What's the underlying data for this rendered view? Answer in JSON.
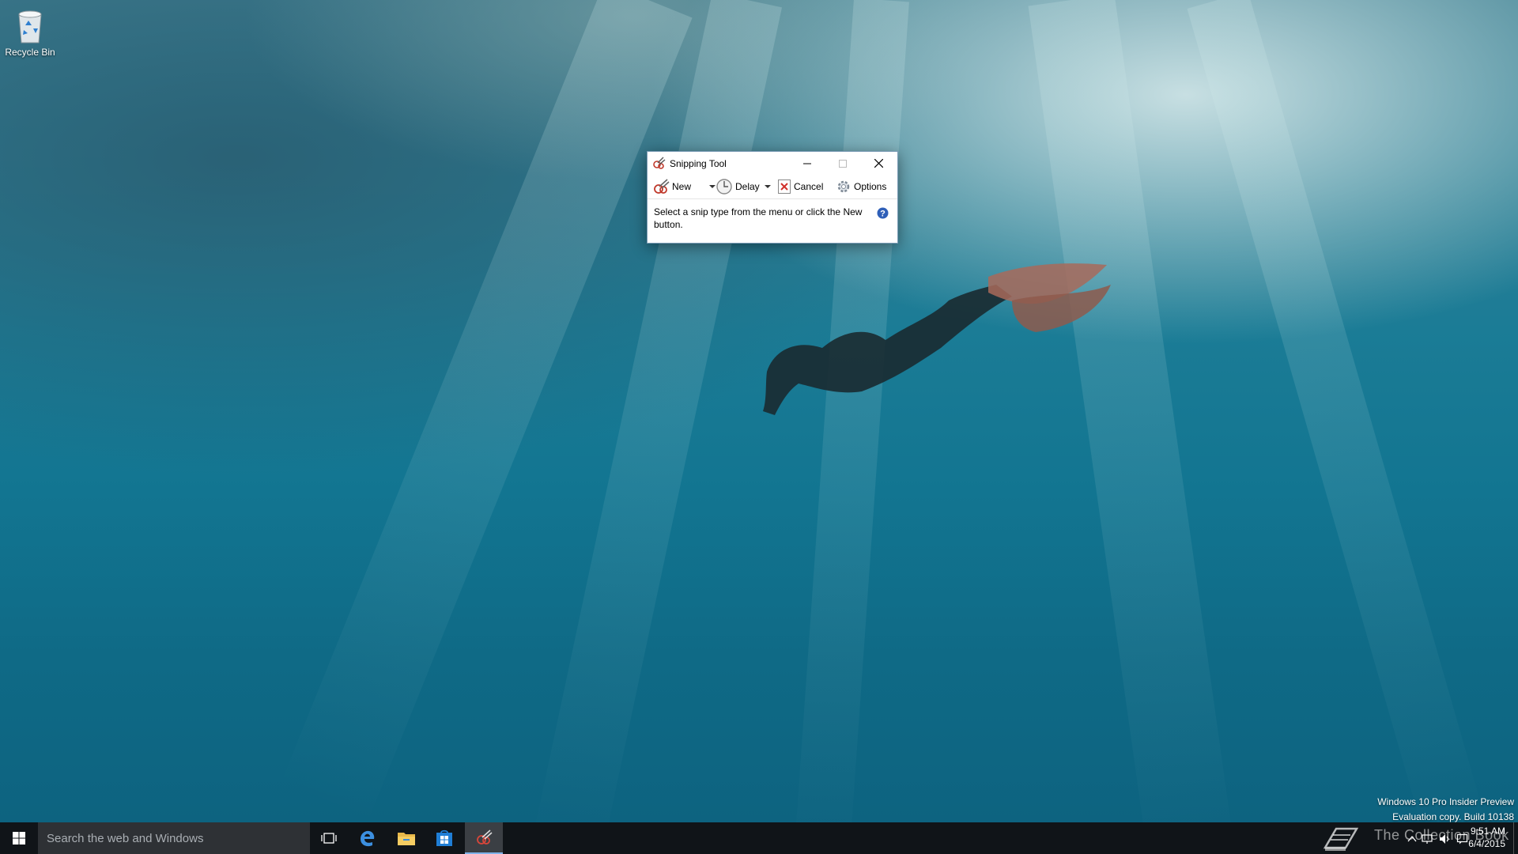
{
  "desktop": {
    "icons": [
      {
        "label": "Recycle Bin",
        "icon": "recycle-bin-icon"
      }
    ]
  },
  "snipping_tool": {
    "title": "Snipping Tool",
    "window_controls": {
      "minimize": "minimize-icon",
      "maximize": "maximize-icon",
      "close": "close-icon"
    },
    "toolbar": {
      "new_label": "New",
      "delay_label": "Delay",
      "cancel_label": "Cancel",
      "options_label": "Options"
    },
    "message": "Select a snip type from the menu or click the New button.",
    "help_icon": "help-icon"
  },
  "watermark": {
    "line1": "Windows 10 Pro Insider Preview",
    "line2": "Evaluation copy. Build 10138"
  },
  "taskbar": {
    "search_placeholder": "Search the web and Windows",
    "pinned": [
      "task-view-icon",
      "edge-icon",
      "file-explorer-icon",
      "store-icon",
      "snipping-tool-icon"
    ],
    "tray": {
      "brand_overlay": "The Collection Book",
      "time": "9:51 AM",
      "date": "6/4/2015"
    }
  },
  "colors": {
    "taskbar": "#101418",
    "search_box": "#2e3135",
    "active_indicator": "#7fb2e8",
    "window_border": "#7a9bb5"
  }
}
